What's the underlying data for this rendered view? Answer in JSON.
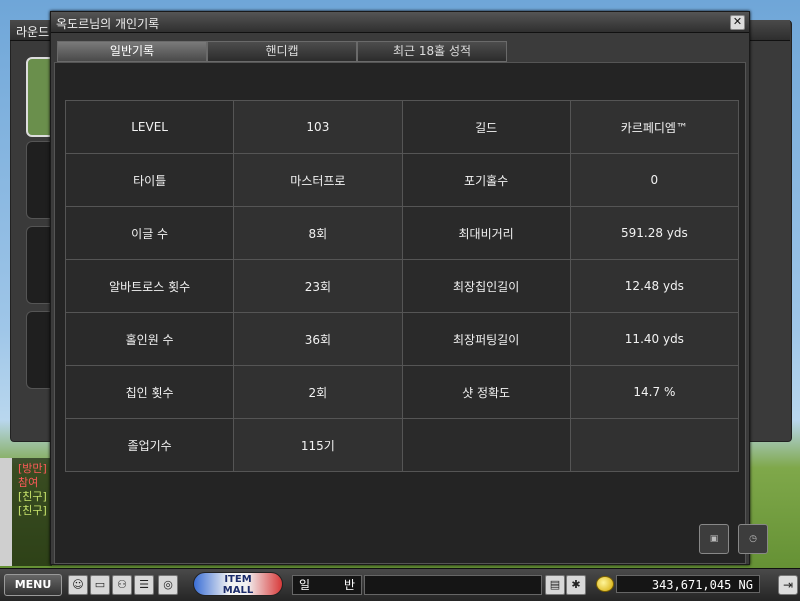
{
  "background": {
    "window_title": "라운드"
  },
  "chat": {
    "lines": [
      "[방만]",
      "참여",
      "[친구]",
      "[친구]"
    ]
  },
  "dialog": {
    "title": "옥도르님의 개인기록",
    "close_glyph": "✕",
    "tabs": [
      {
        "label": "일반기록",
        "active": true
      },
      {
        "label": "핸디캡",
        "active": false
      },
      {
        "label": "최근 18홀 성적",
        "active": false
      }
    ],
    "rows": [
      {
        "label1": "LEVEL",
        "value1": "103",
        "label2": "길드",
        "value2": "카르페디엠™"
      },
      {
        "label1": "타이틀",
        "value1": "마스터프로",
        "label2": "포기홀수",
        "value2": "0"
      },
      {
        "label1": "이글 수",
        "value1": "8회",
        "label2": "최대비거리",
        "value2": "591.28 yds"
      },
      {
        "label1": "알바트로스 횟수",
        "value1": "23회",
        "label2": "최장칩인길이",
        "value2": "12.48 yds"
      },
      {
        "label1": "홀인원 수",
        "value1": "36회",
        "label2": "최장퍼팅길이",
        "value2": "11.40 yds"
      },
      {
        "label1": "칩인 횟수",
        "value1": "2회",
        "label2": "샷 정확도",
        "value2": "14.7 %"
      },
      {
        "label1": "졸업기수",
        "value1": "115기",
        "label2": "",
        "value2": ""
      }
    ]
  },
  "bottombar": {
    "menu_label": "MENU",
    "item_mall_line1": "ITEM",
    "item_mall_line2": "MALL",
    "channel_a": "일",
    "channel_b": "반",
    "money": "343,671,045 NG"
  },
  "colors": {
    "dialog_bg": "#3b3b3b",
    "cell_label_bg": "#2a2a2a",
    "cell_value_bg": "#313131"
  }
}
